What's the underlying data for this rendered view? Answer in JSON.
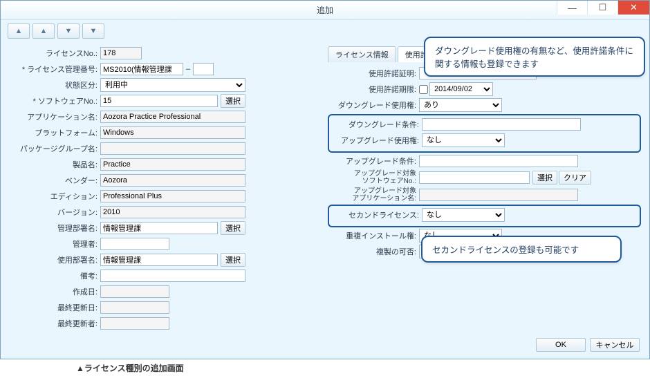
{
  "window": {
    "title": "追加"
  },
  "toolbar": {
    "first": "⤒",
    "up": "▲",
    "down": "▼",
    "last": "⤓"
  },
  "left": {
    "license_no_label": "ライセンスNo.:",
    "license_no": "178",
    "mgmt_no_label": "* ライセンス管理番号:",
    "mgmt_no": "MS2010(情報管理課",
    "status_label": "状態区分:",
    "status": "利用中",
    "sw_no_label": "* ソフトウェアNo.:",
    "sw_no": "15",
    "select_btn": "選択",
    "app_name_label": "アプリケーション名:",
    "app_name": "Aozora Practice Professional",
    "platform_label": "プラットフォーム:",
    "platform": "Windows",
    "pkg_group_label": "パッケージグループ名:",
    "pkg_group": "",
    "product_label": "製品名:",
    "product": "Practice",
    "vendor_label": "ベンダー:",
    "vendor": "Aozora",
    "edition_label": "エディション:",
    "edition": "Professional Plus",
    "version_label": "バージョン:",
    "version": "2010",
    "mgmt_dept_label": "管理部署名:",
    "mgmt_dept": "情報管理課",
    "manager_label": "管理者:",
    "manager": "",
    "use_dept_label": "使用部署名:",
    "use_dept": "情報管理課",
    "remarks_label": "備考:",
    "remarks": "",
    "created_label": "作成日:",
    "created": "",
    "updated_label": "最終更新日:",
    "updated": "",
    "updater_label": "最終更新者:",
    "updater": ""
  },
  "tabs": {
    "t1": "ライセンス情報",
    "t2": "使用許諾"
  },
  "right": {
    "cert_label": "使用許諾証明:",
    "expiry_label": "使用許諾期限:",
    "expiry_date": "2014/09/02",
    "downgrade_label": "ダウングレード使用権:",
    "downgrade": "あり",
    "dg_cond_label": "ダウングレード条件:",
    "upgrade_right_label": "アップグレード使用権:",
    "upgrade_right": "なし",
    "ug_cond_label": "アップグレード条件:",
    "ug_sw_label1": "アップグレード対象",
    "ug_sw_label2": "ソフトウェアNo.:",
    "ug_app_label1": "アップグレード対象",
    "ug_app_label2": "アプリケーション名:",
    "second_label": "セカンドライセンス:",
    "second": "なし",
    "dup_install_label": "重複インストール権:",
    "dup_install": "なし",
    "copy_label": "複製の可否:",
    "copy": "－",
    "clear_btn": "クリア"
  },
  "footer": {
    "ok": "OK",
    "cancel": "キャンセル"
  },
  "callouts": {
    "top": "ダウングレード使用権の有無など、使用許諾条件に関する情報も登録できます",
    "bottom": "セカンドライセンスの登録も可能です"
  },
  "caption": "▲ライセンス種別の追加画面"
}
